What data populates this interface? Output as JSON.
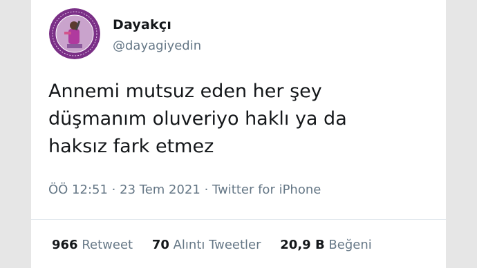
{
  "user": {
    "display_name": "Dayakçı",
    "handle": "@dayagiyedin",
    "avatar_icon": "profile-avatar-icon"
  },
  "tweet": {
    "text": "Annemi mutsuz eden her şey\ndüşmanım oluveriyo haklı ya da\nhaksız fark etmez",
    "time": "ÖÖ 12:51",
    "date": "23 Tem 2021",
    "source": "Twitter for iPhone",
    "separator": "·"
  },
  "stats": {
    "retweets_count": "966",
    "retweets_label": "Retweet",
    "quotes_count": "70",
    "quotes_label": "Alıntı Tweetler",
    "likes_count": "20,9 B",
    "likes_label": "Beğeni"
  },
  "colors": {
    "background": "#e6e6e6",
    "card": "#ffffff",
    "text_primary": "#14171a",
    "text_secondary": "#657786",
    "avatar_purple": "#7a2f86"
  }
}
